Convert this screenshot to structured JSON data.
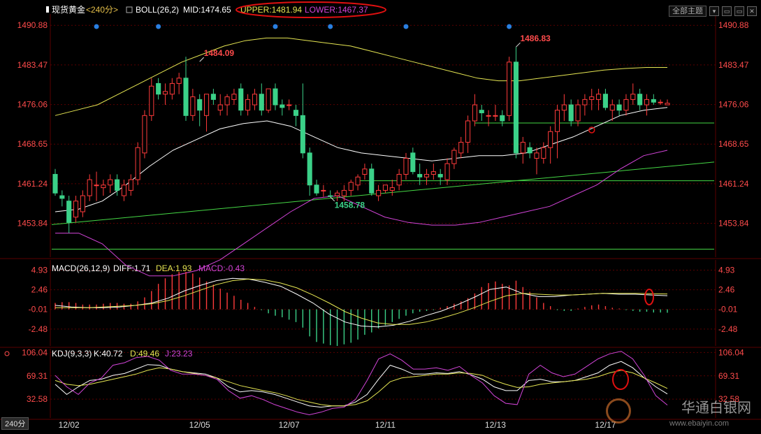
{
  "header": {
    "symbol": "现货黄金",
    "period": "<240分>",
    "boll_label": "BOLL(26,2)",
    "mid": "MID:1474.65",
    "upper": "UPPER:1481.94",
    "lower": "LOWER:1467.37",
    "main_indicators_btn": "全部主题",
    "win_buttons": [
      "▾",
      "▭",
      "▭",
      "✕"
    ]
  },
  "macd_header": {
    "label": "MACD(26,12,9)",
    "diff": "DIFF:1.71",
    "dea": "DEA:1.93",
    "macd": "MACD:-0.43"
  },
  "kdj_header": {
    "label": "KDJ(9,3,3)",
    "k": "K:40.72",
    "d": "D:49.46",
    "j": "J:23.23"
  },
  "period_tag": "240分",
  "watermark": {
    "text": "华通白银网",
    "url": "www.ebaiyin.com"
  },
  "colors": {
    "up": "#ff3b3b",
    "down": "#3bd188",
    "mid": "#ffffff",
    "upper": "#e6e652",
    "lower": "#d244d8",
    "trend": "#45d845",
    "grid": "#5a0000",
    "axis": "#ff4b4b",
    "ann": "#e0e0e0"
  },
  "chart_data": [
    {
      "type": "candlestick",
      "title": "BOLL(26,2)",
      "y_ticks": [
        1490.88,
        1483.47,
        1476.06,
        1468.65,
        1461.24,
        1453.84
      ],
      "ylim": [
        1447.5,
        1493
      ],
      "x_ticks": [
        {
          "i": 2,
          "label": "12/02"
        },
        {
          "i": 21,
          "label": "12/05"
        },
        {
          "i": 34,
          "label": "12/07"
        },
        {
          "i": 48,
          "label": "12/11"
        },
        {
          "i": 64,
          "label": "12/13"
        },
        {
          "i": 80,
          "label": "12/17"
        }
      ],
      "ohlc": [
        [
          1463,
          1464,
          1459,
          1459.5
        ],
        [
          1459,
          1460,
          1457,
          1458.5
        ],
        [
          1458,
          1459,
          1452,
          1454
        ],
        [
          1455,
          1459,
          1454,
          1458
        ],
        [
          1456,
          1460,
          1455,
          1459
        ],
        [
          1459,
          1463,
          1458,
          1462
        ],
        [
          1461,
          1463.5,
          1458,
          1461
        ],
        [
          1460.5,
          1462,
          1459,
          1461
        ],
        [
          1461,
          1463,
          1459.5,
          1462
        ],
        [
          1462,
          1463,
          1459,
          1460
        ],
        [
          1459,
          1462,
          1458,
          1461
        ],
        [
          1460,
          1463,
          1459,
          1462
        ],
        [
          1462,
          1469,
          1461,
          1468
        ],
        [
          1467,
          1475,
          1466,
          1474
        ],
        [
          1474,
          1481,
          1473,
          1479.5
        ],
        [
          1480,
          1481,
          1477,
          1478
        ],
        [
          1478,
          1480,
          1476,
          1478.5
        ],
        [
          1478,
          1481,
          1477,
          1480
        ],
        [
          1480,
          1482,
          1478,
          1481
        ],
        [
          1481,
          1485,
          1473,
          1474
        ],
        [
          1474,
          1479,
          1473,
          1477.5
        ],
        [
          1477,
          1478,
          1472,
          1475
        ],
        [
          1474,
          1478,
          1471,
          1478
        ],
        [
          1478,
          1479,
          1476,
          1477
        ],
        [
          1475,
          1478,
          1474,
          1476
        ],
        [
          1476,
          1478,
          1474,
          1477.5
        ],
        [
          1477,
          1479,
          1476,
          1478
        ],
        [
          1479,
          1480,
          1474,
          1475
        ],
        [
          1475,
          1478,
          1474,
          1477
        ],
        [
          1476,
          1479,
          1475,
          1478
        ],
        [
          1478,
          1480,
          1474,
          1475
        ],
        [
          1475,
          1479,
          1474.5,
          1479
        ],
        [
          1479,
          1480,
          1475,
          1476
        ],
        [
          1476,
          1477,
          1474,
          1475.5
        ],
        [
          1476,
          1477,
          1475,
          1476
        ],
        [
          1475,
          1476,
          1472,
          1474
        ],
        [
          1474,
          1480,
          1466,
          1467
        ],
        [
          1467,
          1468,
          1459,
          1461
        ],
        [
          1461,
          1462,
          1459,
          1459.5
        ],
        [
          1460,
          1461,
          1458.8,
          1460
        ],
        [
          1459,
          1460,
          1458.78,
          1458.9
        ],
        [
          1459,
          1460,
          1458,
          1459.5
        ],
        [
          1459,
          1461,
          1458,
          1460
        ],
        [
          1460,
          1462,
          1459,
          1461.5
        ],
        [
          1461,
          1463,
          1460,
          1462.5
        ],
        [
          1463,
          1465,
          1462,
          1464
        ],
        [
          1464,
          1465,
          1459,
          1459.5
        ],
        [
          1459,
          1461,
          1458,
          1460
        ],
        [
          1460,
          1461,
          1459.5,
          1461
        ],
        [
          1460,
          1462,
          1459,
          1460.5
        ],
        [
          1461,
          1464,
          1460,
          1463
        ],
        [
          1463,
          1467,
          1462,
          1466
        ],
        [
          1467,
          1468,
          1463,
          1463.5
        ],
        [
          1463,
          1465,
          1461,
          1462.5
        ],
        [
          1462.5,
          1464,
          1461,
          1463
        ],
        [
          1463,
          1465,
          1462,
          1463.5
        ],
        [
          1463,
          1464,
          1461,
          1462.5
        ],
        [
          1462,
          1466,
          1461,
          1465
        ],
        [
          1465,
          1468,
          1464,
          1467.5
        ],
        [
          1467,
          1470,
          1466,
          1469
        ],
        [
          1469,
          1474,
          1467,
          1473
        ],
        [
          1473,
          1478,
          1472,
          1476
        ],
        [
          1475,
          1476,
          1473,
          1474.5
        ],
        [
          1474,
          1475,
          1472,
          1474
        ],
        [
          1474,
          1476,
          1473,
          1474
        ],
        [
          1474,
          1475,
          1472,
          1473
        ],
        [
          1474,
          1485,
          1473,
          1484
        ],
        [
          1484,
          1486.83,
          1466,
          1467
        ],
        [
          1467,
          1470,
          1465,
          1469
        ],
        [
          1468,
          1469,
          1466,
          1467
        ],
        [
          1466,
          1468,
          1463,
          1467
        ],
        [
          1466,
          1469,
          1465,
          1468
        ],
        [
          1468,
          1472,
          1465,
          1471
        ],
        [
          1471,
          1476,
          1466,
          1475
        ],
        [
          1475,
          1478,
          1473,
          1476
        ],
        [
          1476,
          1477,
          1472,
          1473
        ],
        [
          1473,
          1477,
          1472,
          1476
        ],
        [
          1476,
          1478,
          1474,
          1477
        ],
        [
          1477,
          1479,
          1475,
          1477.5
        ],
        [
          1477,
          1479,
          1475,
          1478
        ],
        [
          1478,
          1479,
          1475,
          1475.5
        ],
        [
          1475,
          1477,
          1473,
          1476
        ],
        [
          1476,
          1477,
          1474,
          1475
        ],
        [
          1475,
          1478,
          1474,
          1477
        ],
        [
          1477,
          1480,
          1476,
          1478
        ],
        [
          1478,
          1479,
          1475,
          1476
        ],
        [
          1476,
          1478,
          1474,
          1477
        ],
        [
          1477,
          1478,
          1476,
          1476.5
        ],
        [
          1476.5,
          1477,
          1476,
          1476.5
        ],
        [
          1476,
          1477,
          1476,
          1476.3
        ]
      ],
      "boll_upper": [
        1474,
        1475,
        1476,
        1478,
        1480,
        1482,
        1484,
        1485.5,
        1487,
        1488,
        1488.5,
        1488.5,
        1488,
        1487.5,
        1487,
        1486,
        1485,
        1484,
        1483,
        1482,
        1481,
        1480.5,
        1480.5,
        1481,
        1481.5,
        1482,
        1482.5,
        1482.8,
        1483,
        1483
      ],
      "boll_mid": [
        1456,
        1456.5,
        1458,
        1461,
        1464.5,
        1467.5,
        1469.5,
        1471.5,
        1472.5,
        1473,
        1472,
        1470,
        1468,
        1467,
        1466.5,
        1466,
        1465.5,
        1466,
        1466.5,
        1466.5,
        1467,
        1468.5,
        1470,
        1472,
        1474,
        1475,
        1475.5
      ],
      "boll_lower": [
        1452,
        1452,
        1450,
        1446,
        1444,
        1444,
        1445,
        1447,
        1450,
        1453,
        1456,
        1458.5,
        1459,
        1457,
        1455,
        1454,
        1453.5,
        1453.5,
        1454,
        1455,
        1456,
        1457,
        1459,
        1461,
        1464,
        1466.5,
        1467.5
      ],
      "annotations": [
        {
          "i": 21,
          "price": 1484.09,
          "label": "1484.09",
          "kind": "high"
        },
        {
          "i": 67,
          "price": 1486.83,
          "label": "1486.83",
          "kind": "high"
        },
        {
          "i": 40,
          "price": 1458.78,
          "label": "1458.78",
          "kind": "low"
        }
      ],
      "event_dots": [
        6,
        15,
        32,
        40,
        51,
        66
      ]
    },
    {
      "type": "macd",
      "title": "MACD(26,12,9)",
      "y_ticks": [
        4.93,
        2.46,
        -0.01,
        -2.48
      ],
      "ylim": [
        -4.6,
        6.2
      ],
      "histogram": [
        0.8,
        0.9,
        0.9,
        0.8,
        0.6,
        0.6,
        0.6,
        0.7,
        0.8,
        0.8,
        0.7,
        0.7,
        1.0,
        1.5,
        2.3,
        3.2,
        3.9,
        4.4,
        4.7,
        4.7,
        4.5,
        4.0,
        3.5,
        3.1,
        2.6,
        2.1,
        1.7,
        1.2,
        0.8,
        0.3,
        -0.1,
        -0.5,
        -0.8,
        -1.0,
        -1.3,
        -1.6,
        -2.3,
        -3.4,
        -4.1,
        -4.3,
        -4.5,
        -4.6,
        -4.4,
        -4.2,
        -3.8,
        -3.2,
        -2.9,
        -2.4,
        -2.0,
        -1.6,
        -1.2,
        -0.8,
        -0.5,
        -0.3,
        -0.2,
        -0.1,
        0.2,
        0.4,
        0.7,
        1.0,
        1.4,
        2.0,
        2.8,
        3.3,
        3.5,
        3.2,
        3.0,
        3.6,
        2.8,
        2.2,
        1.5,
        0.8,
        0.4,
        -0.1,
        -0.2,
        -0.2,
        0.1,
        0.3,
        0.5,
        0.6,
        0.4,
        0.2,
        0.1,
        -0.1,
        -0.2,
        -0.3,
        -0.3,
        -0.4,
        -0.4,
        -0.43
      ],
      "diff": [
        0.5,
        0.3,
        0.2,
        0.2,
        0.3,
        0.5,
        0.8,
        1.4,
        2.3,
        3.0,
        3.6,
        3.9,
        3.8,
        3.4,
        2.9,
        1.9,
        0.8,
        -0.6,
        -1.6,
        -2.1,
        -2.2,
        -2.0,
        -1.5,
        -0.8,
        -0.2,
        0.6,
        1.5,
        2.5,
        2.8,
        2.0,
        1.6,
        1.6,
        1.8,
        1.9,
        2.0,
        1.9,
        1.9,
        1.8,
        1.71
      ],
      "dea": [
        0.2,
        0.2,
        0.2,
        0.3,
        0.4,
        0.5,
        0.7,
        1.1,
        1.7,
        2.4,
        3.1,
        3.6,
        3.8,
        3.7,
        3.3,
        2.7,
        1.8,
        0.8,
        -0.3,
        -1.1,
        -1.7,
        -1.9,
        -1.9,
        -1.6,
        -1.1,
        -0.5,
        0.2,
        1.0,
        1.7,
        2.0,
        1.9,
        1.8,
        1.8,
        1.9,
        2.0,
        2.0,
        2.0,
        1.97,
        1.93
      ]
    },
    {
      "type": "kdj",
      "title": "KDJ(9,3,3)",
      "y_ticks": [
        106.04,
        69.31,
        32.58
      ],
      "ylim": [
        3,
        112
      ],
      "k": [
        56,
        40,
        52,
        62,
        64,
        70,
        73,
        80,
        87,
        86,
        80,
        76,
        74,
        72,
        66,
        52,
        44,
        46,
        44,
        40,
        34,
        28,
        22,
        20,
        22,
        22,
        28,
        40,
        64,
        86,
        80,
        72,
        72,
        74,
        73,
        76,
        71,
        64,
        52,
        46,
        46,
        62,
        64,
        60,
        60,
        62,
        68,
        74,
        86,
        92,
        82,
        66,
        52,
        40.72
      ],
      "d": [
        62,
        56,
        54,
        56,
        60,
        64,
        68,
        72,
        78,
        82,
        80,
        76,
        73,
        70,
        66,
        60,
        54,
        50,
        46,
        43,
        38,
        32,
        28,
        24,
        22,
        22,
        24,
        30,
        44,
        60,
        66,
        68,
        70,
        72,
        72,
        74,
        73,
        70,
        62,
        56,
        51,
        52,
        56,
        58,
        60,
        62,
        64,
        68,
        74,
        78,
        74,
        66,
        58,
        49.46
      ],
      "j": [
        70,
        52,
        40,
        58,
        66,
        86,
        90,
        98,
        100,
        94,
        78,
        72,
        72,
        70,
        64,
        46,
        34,
        38,
        32,
        24,
        18,
        12,
        8,
        12,
        18,
        20,
        32,
        62,
        96,
        104,
        94,
        80,
        80,
        82,
        78,
        84,
        70,
        58,
        38,
        26,
        24,
        72,
        86,
        74,
        68,
        72,
        84,
        96,
        104,
        108,
        96,
        70,
        38,
        23.23
      ]
    }
  ]
}
